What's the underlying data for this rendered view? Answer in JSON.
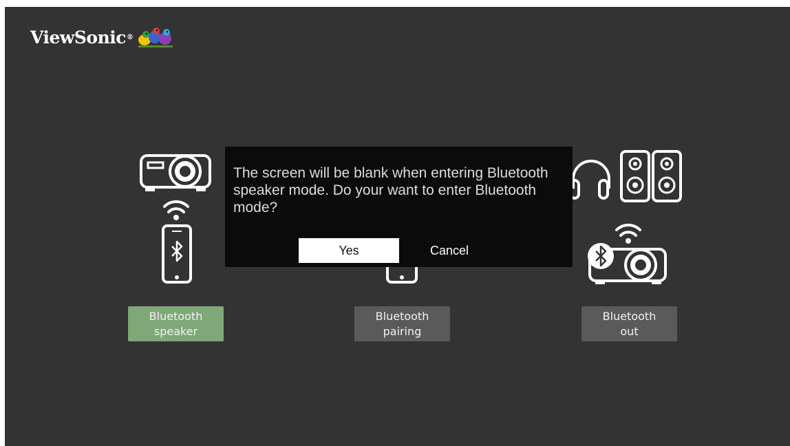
{
  "brand": {
    "name": "ViewSonic",
    "mark": "®",
    "logo_icon": "birds-logo-icon"
  },
  "modes": [
    {
      "line1": "Bluetooth",
      "line2": "speaker",
      "selected": true,
      "icon": "projector-phone-bluetooth-icon"
    },
    {
      "line1": "Bluetooth",
      "line2": "pairing",
      "selected": false,
      "icon": "phone-icon"
    },
    {
      "line1": "Bluetooth",
      "line2": "out",
      "selected": false,
      "icon": "headphones-speakers-projector-icon"
    }
  ],
  "dialog": {
    "message": "The screen will be blank when entering Bluetooth speaker mode. Do your want to enter Bluetooth mode?",
    "yes_label": "Yes",
    "cancel_label": "Cancel",
    "focused_button": "yes"
  },
  "colors": {
    "background": "#333333",
    "selected_button": "#7fa777",
    "normal_button": "#5a5a5a",
    "dialog_background": "#0b0b0b"
  }
}
